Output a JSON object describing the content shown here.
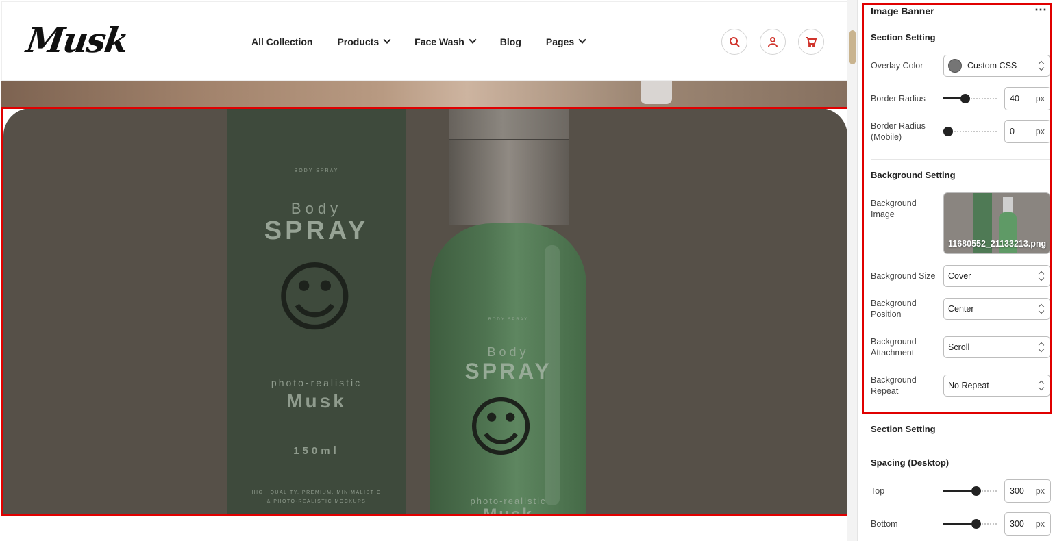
{
  "header": {
    "logo": "Musk",
    "nav": [
      {
        "label": "All Collection",
        "has_dropdown": false
      },
      {
        "label": "Products",
        "has_dropdown": true
      },
      {
        "label": "Face Wash",
        "has_dropdown": true
      },
      {
        "label": "Blog",
        "has_dropdown": false
      },
      {
        "label": "Pages",
        "has_dropdown": true
      }
    ],
    "icons": [
      "search-icon",
      "user-icon",
      "cart-icon"
    ],
    "accent": "#d0342c"
  },
  "banner": {
    "box_lines": [
      "BODY SPRAY",
      "Body",
      "SPRAY",
      "photo-realistic",
      "Musk",
      "150ml",
      "HIGH QUALITY, PREMIUM, MINIMALISTIC",
      "& PHOTO-REALISTIC MOCKUPS"
    ],
    "bottle_lines": [
      "BODY SPRAY",
      "Body",
      "SPRAY",
      "photo-realistic",
      "Musk"
    ],
    "overlay_color": "#565048",
    "highlight": "#e00000"
  },
  "panel": {
    "title": "Image Banner",
    "more": "⋯",
    "section_setting": {
      "heading": "Section Setting",
      "overlay_color": {
        "label": "Overlay Color",
        "value": "Custom CSS",
        "swatch": "#757575"
      },
      "border_radius": {
        "label": "Border Radius",
        "value": "40",
        "unit": "px",
        "level": 0.4
      },
      "border_radius_mobile": {
        "label": "Border Radius (Mobile)",
        "value": "0",
        "unit": "px",
        "level": 0
      }
    },
    "background_setting": {
      "heading": "Background Setting",
      "image": {
        "label": "Background Image",
        "filename": "11680552_21133213.png"
      },
      "size": {
        "label": "Background Size",
        "value": "Cover"
      },
      "position": {
        "label": "Background Position",
        "value": "Center"
      },
      "attachment": {
        "label": "Background Attachment",
        "value": "Scroll"
      },
      "repeat": {
        "label": "Background Repeat",
        "value": "No Repeat"
      }
    },
    "section_setting_2": {
      "heading": "Section Setting"
    },
    "spacing_desktop": {
      "heading": "Spacing (Desktop)",
      "top": {
        "label": "Top",
        "value": "300",
        "unit": "px",
        "level": 0.6
      },
      "bottom": {
        "label": "Bottom",
        "value": "300",
        "unit": "px",
        "level": 0.6
      }
    }
  }
}
